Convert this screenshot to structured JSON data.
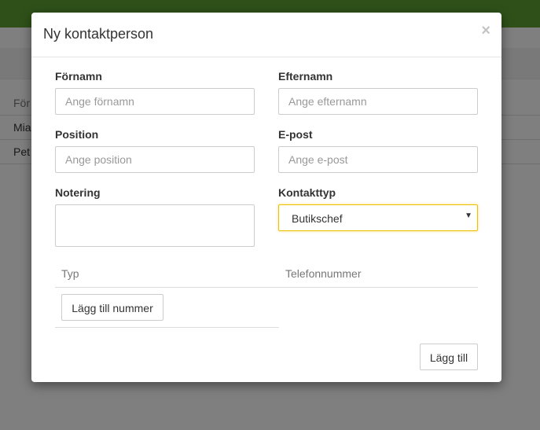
{
  "background": {
    "table_header": "För",
    "rows": [
      "Mia",
      "Pet"
    ]
  },
  "modal": {
    "title": "Ny kontaktperson",
    "close_symbol": "×",
    "fields": {
      "first_name": {
        "label": "Förnamn",
        "placeholder": "Ange förnamn",
        "value": ""
      },
      "last_name": {
        "label": "Efternamn",
        "placeholder": "Ange efternamn",
        "value": ""
      },
      "position": {
        "label": "Position",
        "placeholder": "Ange position",
        "value": ""
      },
      "email": {
        "label": "E-post",
        "placeholder": "Ange e-post",
        "value": ""
      },
      "note": {
        "label": "Notering",
        "value": ""
      },
      "contact_type": {
        "label": "Kontakttyp",
        "selected": "Butikschef"
      }
    },
    "phone_table": {
      "col_type": "Typ",
      "col_number": "Telefonnummer"
    },
    "add_number_button": "Lägg till nummer",
    "submit_button": "Lägg till"
  },
  "colors": {
    "topbar": "#5fa233",
    "select_focus_border": "#f0c000"
  },
  "icons": {
    "close": "close-icon",
    "select_arrow": "caret-down-icon"
  }
}
